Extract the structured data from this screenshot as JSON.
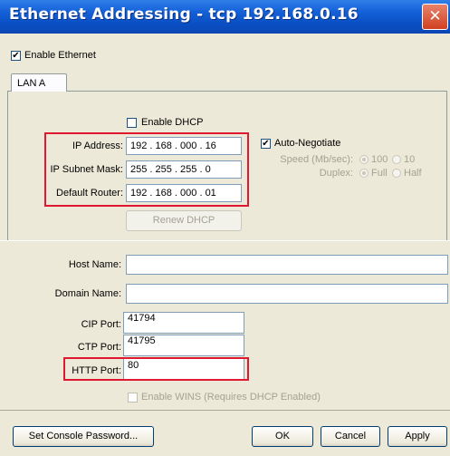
{
  "window": {
    "title": "Ethernet Addressing - tcp 192.168.0.16",
    "close_symbol": "✕"
  },
  "enable_ethernet": {
    "label": "Enable Ethernet",
    "checked": true
  },
  "tabs": [
    {
      "label": "LAN A"
    }
  ],
  "dhcp": {
    "label": "Enable DHCP",
    "checked": false
  },
  "ip_address": {
    "label": "IP Address:",
    "value": "192 . 168 . 000 . 16"
  },
  "subnet_mask": {
    "label": "IP Subnet Mask:",
    "value": "255 . 255 . 255 . 0"
  },
  "default_router": {
    "label": "Default Router:",
    "value": "192 . 168 . 000 . 01"
  },
  "auto_negotiate": {
    "label": "Auto-Negotiate",
    "checked": true
  },
  "speed": {
    "label": "Speed (Mb/sec):",
    "options": [
      "100",
      "10"
    ],
    "selected": "100"
  },
  "duplex": {
    "label": "Duplex:",
    "options": [
      "Full",
      "Half"
    ],
    "selected": "Full"
  },
  "renew_dhcp": {
    "label": "Renew DHCP"
  },
  "host_name": {
    "label": "Host Name:",
    "value": ""
  },
  "domain_name": {
    "label": "Domain Name:",
    "value": ""
  },
  "cip_port": {
    "label": "CIP Port:",
    "value": "41794"
  },
  "ctp_port": {
    "label": "CTP Port:",
    "value": "41795"
  },
  "http_port": {
    "label": "HTTP Port:",
    "value": "80"
  },
  "wins": {
    "label": "Enable WINS (Requires DHCP Enabled)",
    "checked": false
  },
  "buttons": {
    "set_console_password": "Set Console Password...",
    "ok": "OK",
    "cancel": "Cancel",
    "apply": "Apply"
  },
  "colors": {
    "titlebar": "#0a4fc4",
    "highlight": "#e01930",
    "face": "#ece9d8"
  }
}
